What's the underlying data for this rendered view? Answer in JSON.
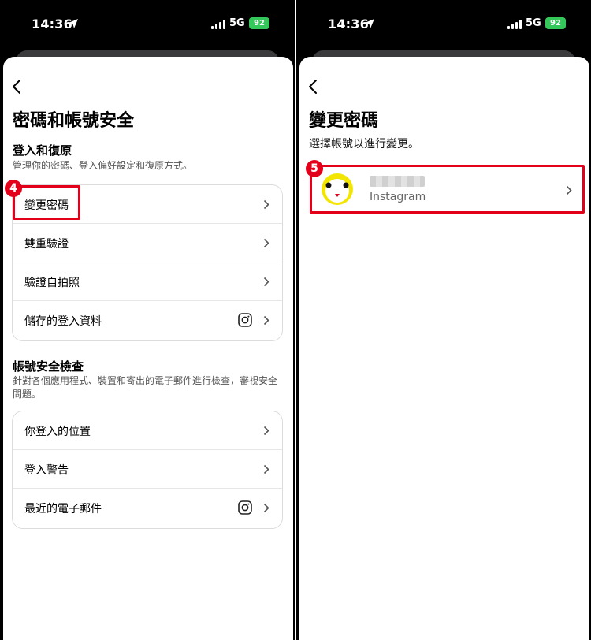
{
  "status": {
    "time": "14:36",
    "network": "5G",
    "battery": "92"
  },
  "left": {
    "title": "密碼和帳號安全",
    "login_section": {
      "title": "登入和復原",
      "description": "管理你的密碼、登入偏好設定和復原方式。",
      "items": [
        {
          "label": "變更密碼"
        },
        {
          "label": "雙重驗證"
        },
        {
          "label": "驗證自拍照"
        },
        {
          "label": "儲存的登入資料"
        }
      ]
    },
    "security_section": {
      "title": "帳號安全檢查",
      "description": "針對各個應用程式、裝置和寄出的電子郵件進行檢查，審視安全問題。",
      "items": [
        {
          "label": "你登入的位置"
        },
        {
          "label": "登入警告"
        },
        {
          "label": "最近的電子郵件"
        }
      ]
    },
    "step_badge": "4"
  },
  "right": {
    "title": "變更密碼",
    "subtitle": "選擇帳號以進行變更。",
    "account": {
      "platform": "Instagram"
    },
    "step_badge": "5"
  },
  "colors": {
    "highlight": "#e3001b",
    "battery": "#34c759"
  },
  "icons": [
    "back-chevron-icon",
    "chevron-right-icon",
    "instagram-icon",
    "location-arrow-icon",
    "signal-icon"
  ]
}
